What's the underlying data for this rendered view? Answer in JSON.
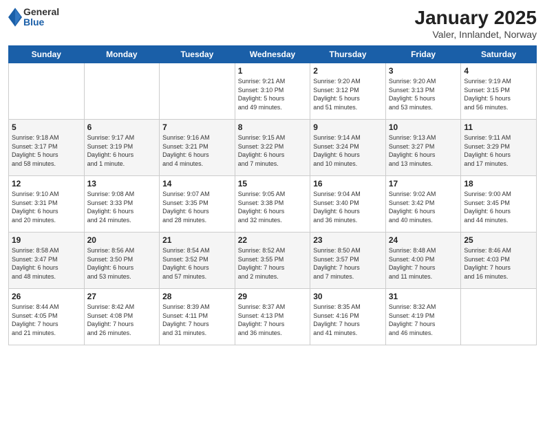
{
  "logo": {
    "general": "General",
    "blue": "Blue"
  },
  "title": "January 2025",
  "subtitle": "Valer, Innlandet, Norway",
  "days_header": [
    "Sunday",
    "Monday",
    "Tuesday",
    "Wednesday",
    "Thursday",
    "Friday",
    "Saturday"
  ],
  "weeks": [
    [
      {
        "day": "",
        "info": ""
      },
      {
        "day": "",
        "info": ""
      },
      {
        "day": "",
        "info": ""
      },
      {
        "day": "1",
        "info": "Sunrise: 9:21 AM\nSunset: 3:10 PM\nDaylight: 5 hours\nand 49 minutes."
      },
      {
        "day": "2",
        "info": "Sunrise: 9:20 AM\nSunset: 3:12 PM\nDaylight: 5 hours\nand 51 minutes."
      },
      {
        "day": "3",
        "info": "Sunrise: 9:20 AM\nSunset: 3:13 PM\nDaylight: 5 hours\nand 53 minutes."
      },
      {
        "day": "4",
        "info": "Sunrise: 9:19 AM\nSunset: 3:15 PM\nDaylight: 5 hours\nand 56 minutes."
      }
    ],
    [
      {
        "day": "5",
        "info": "Sunrise: 9:18 AM\nSunset: 3:17 PM\nDaylight: 5 hours\nand 58 minutes."
      },
      {
        "day": "6",
        "info": "Sunrise: 9:17 AM\nSunset: 3:19 PM\nDaylight: 6 hours\nand 1 minute."
      },
      {
        "day": "7",
        "info": "Sunrise: 9:16 AM\nSunset: 3:21 PM\nDaylight: 6 hours\nand 4 minutes."
      },
      {
        "day": "8",
        "info": "Sunrise: 9:15 AM\nSunset: 3:22 PM\nDaylight: 6 hours\nand 7 minutes."
      },
      {
        "day": "9",
        "info": "Sunrise: 9:14 AM\nSunset: 3:24 PM\nDaylight: 6 hours\nand 10 minutes."
      },
      {
        "day": "10",
        "info": "Sunrise: 9:13 AM\nSunset: 3:27 PM\nDaylight: 6 hours\nand 13 minutes."
      },
      {
        "day": "11",
        "info": "Sunrise: 9:11 AM\nSunset: 3:29 PM\nDaylight: 6 hours\nand 17 minutes."
      }
    ],
    [
      {
        "day": "12",
        "info": "Sunrise: 9:10 AM\nSunset: 3:31 PM\nDaylight: 6 hours\nand 20 minutes."
      },
      {
        "day": "13",
        "info": "Sunrise: 9:08 AM\nSunset: 3:33 PM\nDaylight: 6 hours\nand 24 minutes."
      },
      {
        "day": "14",
        "info": "Sunrise: 9:07 AM\nSunset: 3:35 PM\nDaylight: 6 hours\nand 28 minutes."
      },
      {
        "day": "15",
        "info": "Sunrise: 9:05 AM\nSunset: 3:38 PM\nDaylight: 6 hours\nand 32 minutes."
      },
      {
        "day": "16",
        "info": "Sunrise: 9:04 AM\nSunset: 3:40 PM\nDaylight: 6 hours\nand 36 minutes."
      },
      {
        "day": "17",
        "info": "Sunrise: 9:02 AM\nSunset: 3:42 PM\nDaylight: 6 hours\nand 40 minutes."
      },
      {
        "day": "18",
        "info": "Sunrise: 9:00 AM\nSunset: 3:45 PM\nDaylight: 6 hours\nand 44 minutes."
      }
    ],
    [
      {
        "day": "19",
        "info": "Sunrise: 8:58 AM\nSunset: 3:47 PM\nDaylight: 6 hours\nand 48 minutes."
      },
      {
        "day": "20",
        "info": "Sunrise: 8:56 AM\nSunset: 3:50 PM\nDaylight: 6 hours\nand 53 minutes."
      },
      {
        "day": "21",
        "info": "Sunrise: 8:54 AM\nSunset: 3:52 PM\nDaylight: 6 hours\nand 57 minutes."
      },
      {
        "day": "22",
        "info": "Sunrise: 8:52 AM\nSunset: 3:55 PM\nDaylight: 7 hours\nand 2 minutes."
      },
      {
        "day": "23",
        "info": "Sunrise: 8:50 AM\nSunset: 3:57 PM\nDaylight: 7 hours\nand 7 minutes."
      },
      {
        "day": "24",
        "info": "Sunrise: 8:48 AM\nSunset: 4:00 PM\nDaylight: 7 hours\nand 11 minutes."
      },
      {
        "day": "25",
        "info": "Sunrise: 8:46 AM\nSunset: 4:03 PM\nDaylight: 7 hours\nand 16 minutes."
      }
    ],
    [
      {
        "day": "26",
        "info": "Sunrise: 8:44 AM\nSunset: 4:05 PM\nDaylight: 7 hours\nand 21 minutes."
      },
      {
        "day": "27",
        "info": "Sunrise: 8:42 AM\nSunset: 4:08 PM\nDaylight: 7 hours\nand 26 minutes."
      },
      {
        "day": "28",
        "info": "Sunrise: 8:39 AM\nSunset: 4:11 PM\nDaylight: 7 hours\nand 31 minutes."
      },
      {
        "day": "29",
        "info": "Sunrise: 8:37 AM\nSunset: 4:13 PM\nDaylight: 7 hours\nand 36 minutes."
      },
      {
        "day": "30",
        "info": "Sunrise: 8:35 AM\nSunset: 4:16 PM\nDaylight: 7 hours\nand 41 minutes."
      },
      {
        "day": "31",
        "info": "Sunrise: 8:32 AM\nSunset: 4:19 PM\nDaylight: 7 hours\nand 46 minutes."
      },
      {
        "day": "",
        "info": ""
      }
    ]
  ]
}
